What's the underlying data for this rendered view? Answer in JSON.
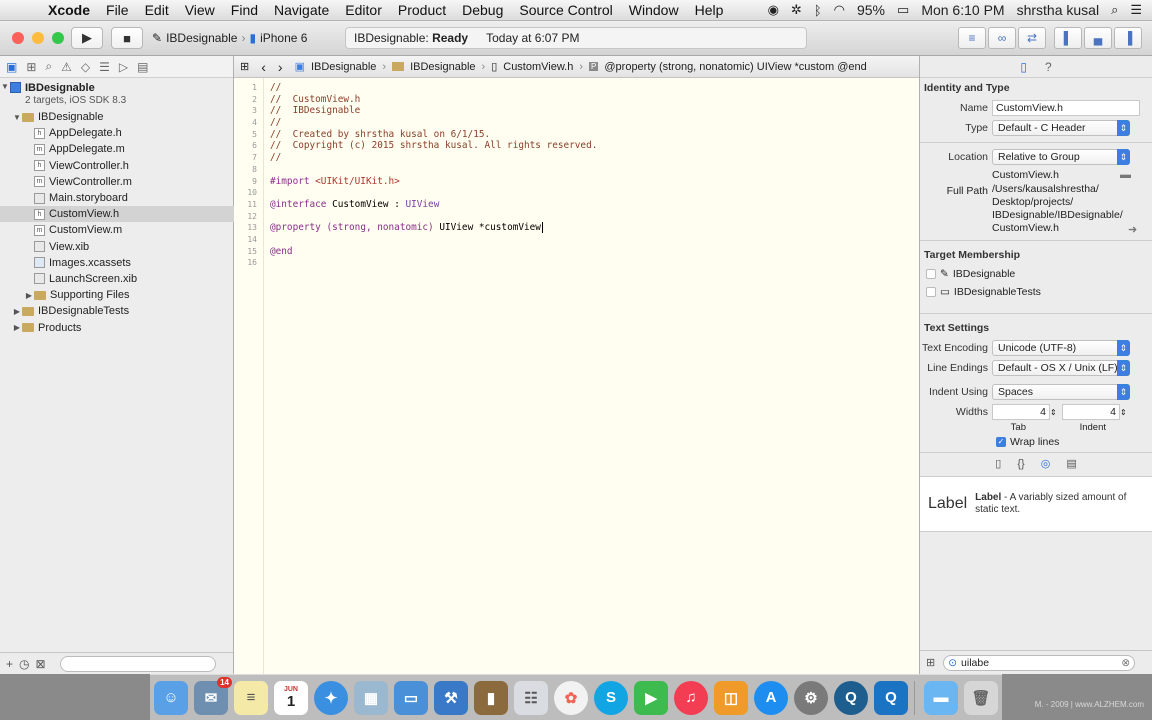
{
  "menubar": {
    "app": "Xcode",
    "items": [
      "File",
      "Edit",
      "View",
      "Find",
      "Navigate",
      "Editor",
      "Product",
      "Debug",
      "Source Control",
      "Window",
      "Help"
    ],
    "battery": "95%",
    "clock": "Mon 6:10 PM",
    "user": "shrstha kusal"
  },
  "toolbar": {
    "scheme": "IBDesignable",
    "device": "iPhone 6",
    "status_project": "IBDesignable:",
    "status_state": "Ready",
    "status_time": "Today at 6:07 PM"
  },
  "navigator": {
    "project": "IBDesignable",
    "project_sub": "2 targets, iOS SDK 8.3",
    "group": "IBDesignable",
    "files": [
      "AppDelegate.h",
      "AppDelegate.m",
      "ViewController.h",
      "ViewController.m",
      "Main.storyboard",
      "CustomView.h",
      "CustomView.m",
      "View.xib",
      "Images.xcassets",
      "LaunchScreen.xib"
    ],
    "supporting": "Supporting Files",
    "tests": "IBDesignableTests",
    "products": "Products"
  },
  "jumpbar": {
    "project": "IBDesignable",
    "group": "IBDesignable",
    "file": "CustomView.h",
    "symbol": "@property (strong, nonatomic) UIView *custom @end"
  },
  "code": {
    "line_numbers": [
      "1",
      "2",
      "3",
      "4",
      "5",
      "6",
      "7",
      "8",
      "9",
      "10",
      "11",
      "12",
      "13",
      "14",
      "15",
      "16"
    ],
    "l1": "//",
    "l2": "//  CustomView.h",
    "l3": "//  IBDesignable",
    "l4": "//",
    "l5": "//  Created by shrstha kusal on 6/1/15.",
    "l6": "//  Copyright (c) 2015 shrstha kusal. All rights reserved.",
    "l7": "//",
    "l9a": "#import ",
    "l9b": "<UIKit/UIKit.h>",
    "l11a": "@interface ",
    "l11b": "CustomView",
    "l11c": " : ",
    "l11d": "UIView",
    "l13a": "@property ",
    "l13b": "(strong, nonatomic) ",
    "l13c": "UIView *customView",
    "l15": "@end"
  },
  "inspector": {
    "identity_head": "Identity and Type",
    "name_label": "Name",
    "name_value": "CustomView.h",
    "type_label": "Type",
    "type_value": "Default - C Header",
    "location_label": "Location",
    "location_value": "Relative to Group",
    "location_file": "CustomView.h",
    "fullpath_label": "Full Path",
    "fullpath_1": "/Users/kausalshrestha/",
    "fullpath_2": "Desktop/projects/",
    "fullpath_3": "IBDesignable/IBDesignable/",
    "fullpath_4": "CustomView.h",
    "membership_head": "Target Membership",
    "member1": "IBDesignable",
    "member2": "IBDesignableTests",
    "text_head": "Text Settings",
    "encoding_label": "Text Encoding",
    "encoding_value": "Unicode (UTF-8)",
    "endings_label": "Line Endings",
    "endings_value": "Default - OS X / Unix (LF)",
    "indent_label": "Indent Using",
    "indent_value": "Spaces",
    "widths_label": "Widths",
    "tab_value": "4",
    "indent_width_value": "4",
    "tab_label": "Tab",
    "indent_sub_label": "Indent",
    "wrap_label": "Wrap lines",
    "lib_big": "Label",
    "lib_title": "Label",
    "lib_desc": " - A variably sized amount of static text.",
    "search_value": "uilabe"
  },
  "dock": {
    "calendar_month": "JUN",
    "calendar_day": "1",
    "mail_badge": "14"
  },
  "watermark": "M. - 2009 | www.ALZHEM.com"
}
